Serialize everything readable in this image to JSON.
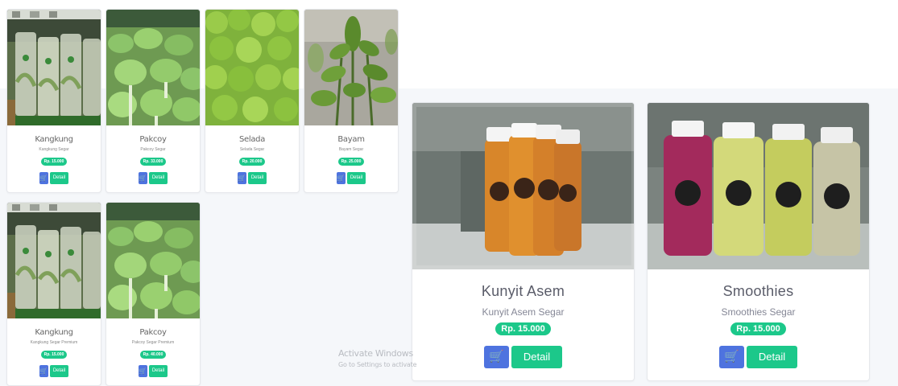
{
  "products_small": [
    {
      "name": "Kangkung",
      "subtitle": "Kangkung Segar",
      "price": "Rp. 15.000",
      "detail_label": "Detail",
      "image": "packed-kangkung-photo"
    },
    {
      "name": "Pakcoy",
      "subtitle": "Pakcoy Segar",
      "price": "Rp. 33.000",
      "detail_label": "Detail",
      "image": "pakcoy-hydroponic-photo"
    },
    {
      "name": "Selada",
      "subtitle": "Selada Segar",
      "price": "Rp. 20.000",
      "detail_label": "Detail",
      "image": "lettuce-field-photo"
    },
    {
      "name": "Bayam",
      "subtitle": "Bayam Segar",
      "price": "Rp. 25.000",
      "detail_label": "Detail",
      "image": "spinach-plant-photo"
    },
    {
      "name": "Kangkung",
      "subtitle": "Kangkung Segar Premium",
      "price": "Rp. 15.000",
      "detail_label": "Detail",
      "image": "packed-kangkung-photo"
    },
    {
      "name": "Pakcoy",
      "subtitle": "Pakcoy Segar Premium",
      "price": "Rp. 40.000",
      "detail_label": "Detail",
      "image": "pakcoy-hydroponic-photo"
    }
  ],
  "products_large": [
    {
      "name": "Kunyit Asem",
      "subtitle": "Kunyit Asem Segar",
      "price": "Rp. 15.000",
      "detail_label": "Detail",
      "image": "kunyit-asem-bottles-photo"
    },
    {
      "name": "Smoothies",
      "subtitle": "Smoothies Segar",
      "price": "Rp. 15.000",
      "detail_label": "Detail",
      "image": "smoothies-bottles-photo"
    }
  ],
  "watermark": {
    "title": "Activate Windows",
    "subtitle": "Go to Settings to activate"
  },
  "colors": {
    "accent_green": "#1cc88a",
    "accent_blue": "#4e73df",
    "panel_bg": "#f5f7fa"
  },
  "icons": {
    "cart": "shopping-cart-icon"
  }
}
